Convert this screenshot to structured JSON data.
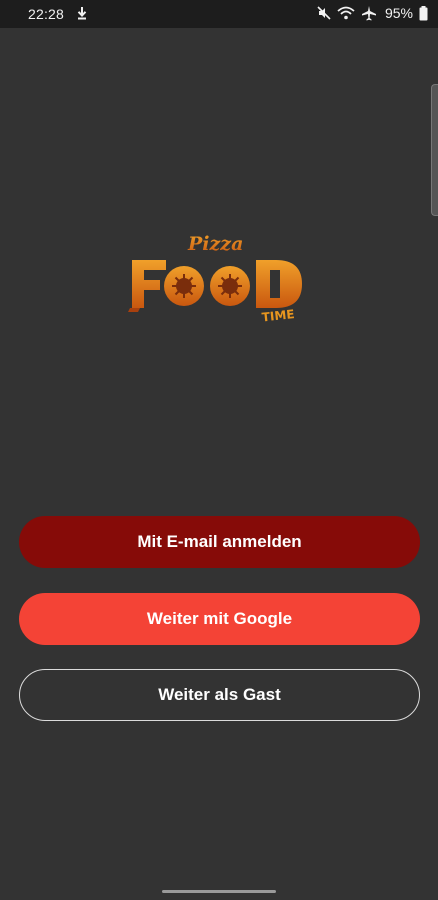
{
  "status_bar": {
    "time": "22:28",
    "battery": "95%",
    "icons": [
      "download-icon",
      "mute-icon",
      "wifi-icon",
      "airplane-icon",
      "battery-icon"
    ]
  },
  "logo": {
    "lettering": [
      "Pizza",
      "FOOD",
      "TIME"
    ],
    "colors": {
      "primary": "#e58c1a",
      "dark": "#b3440f"
    }
  },
  "buttons": {
    "email": "Mit E-mail anmelden",
    "google": "Weiter mit Google",
    "guest": "Weiter als Gast"
  },
  "colors": {
    "background": "#333333",
    "email_button": "#860b08",
    "google_button": "#f44336",
    "guest_border": "#dcdcdc"
  }
}
